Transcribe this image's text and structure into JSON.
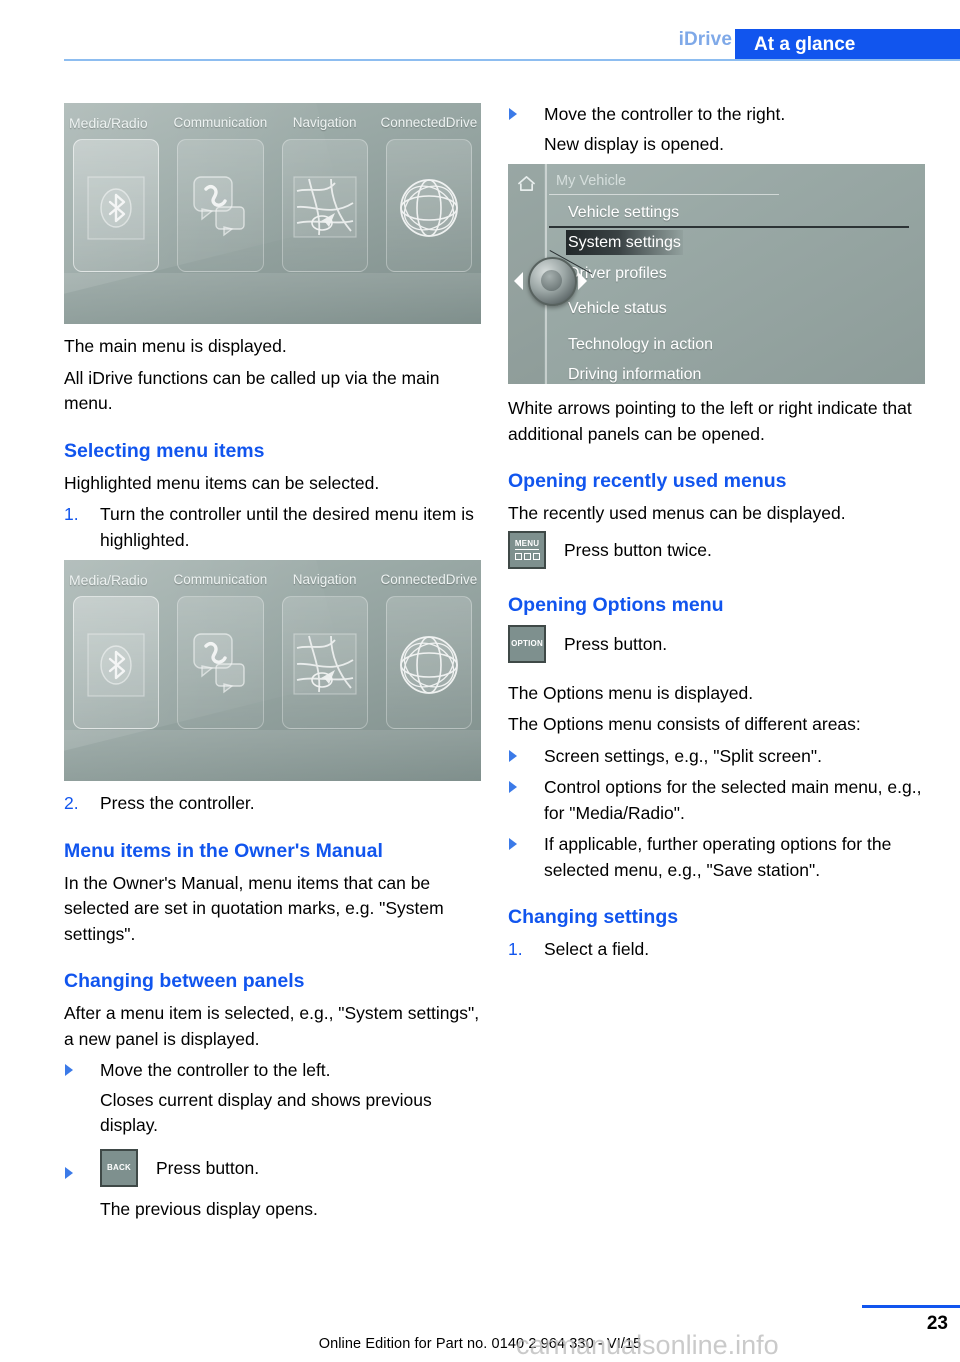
{
  "header": {
    "chapter": "iDrive",
    "section": "At a glance",
    "accent_color": "#1155ee",
    "chapter_color": "#7fa9e8",
    "rule_color": "#8dbdf0"
  },
  "idrive_screenshot": {
    "tiles": [
      {
        "label": "Media/Radio",
        "icon": "bluetooth-icon",
        "active": true
      },
      {
        "label": "Communication",
        "icon": "speech-bubble-phone-icon",
        "active": false
      },
      {
        "label": "Navigation",
        "icon": "map-icon",
        "active": false
      },
      {
        "label": "ConnectedDrive",
        "icon": "globe-icon",
        "active": false
      }
    ]
  },
  "my_vehicle_screenshot": {
    "home_icon": "home-icon",
    "title": "My Vehicle",
    "items": [
      {
        "label": "Vehicle settings",
        "selected": false
      },
      {
        "label": "System settings",
        "selected": true
      },
      {
        "label": "Driver profiles",
        "selected": false
      },
      {
        "label": "Vehicle status",
        "selected": false
      },
      {
        "label": "Technology in action",
        "selected": false
      },
      {
        "label": "Driving information",
        "selected": false
      }
    ],
    "left_arrow": "arrow-left-icon",
    "right_arrow": "arrow-right-icon",
    "controller": "idrive-controller-knob"
  },
  "left_column": {
    "p_main_menu": "The main menu is displayed.",
    "p_all_functions": "All iDrive functions can be called up via the main menu.",
    "h_selecting": "Selecting menu items",
    "p_highlighted": "Highlighted menu items can be selected.",
    "step1_num": "1.",
    "step1_text": "Turn the controller until the desired menu item is highlighted.",
    "step2_num": "2.",
    "step2_text": "Press the controller.",
    "h_menu_items_manual": "Menu items in the Owner's Manual",
    "p_manual_body": "In the Owner's Manual, menu items that can be selected are set in quotation marks, e.g. \"System settings\".",
    "h_changing_panels": "Changing between panels",
    "p_after_selected": "After a menu item is selected, e.g., \"System settings\", a new panel is displayed.",
    "b_move_left": "Move the controller to the left.",
    "p_closes_current": "Closes current display and shows previous display.",
    "back_button_label": "BACK",
    "b_press_button": "Press button.",
    "p_previous_opens": "The previous display opens."
  },
  "right_column": {
    "b_move_right": "Move the controller to the right.",
    "p_new_display": "New display is opened.",
    "p_white_arrows": "White arrows pointing to the left or right indicate that additional panels can be opened.",
    "h_recently_used": "Opening recently used menus",
    "p_recently_used": "The recently used menus can be displayed.",
    "menu_button_label": "MENU",
    "p_press_twice": "Press button twice.",
    "h_options_menu": "Opening Options menu",
    "option_button_label": "OPTION",
    "p_press_button": "Press button.",
    "p_options_displayed": "The Options menu is displayed.",
    "p_options_consists": "The Options menu consists of different areas:",
    "b_screen_settings": "Screen settings, e.g., \"Split screen\".",
    "b_control_options": "Control options for the selected main menu, e.g., for \"Media/Radio\".",
    "b_if_applicable": "If applicable, further operating options for the selected menu, e.g., \"Save station\".",
    "h_changing_settings": "Changing settings",
    "step1_num": "1.",
    "step1_text": "Select a field."
  },
  "footer": {
    "page_number": "23",
    "note": "Online Edition for Part no. 0140 2 964 330 - VI/15",
    "watermark": "carmanualsonline.info"
  }
}
